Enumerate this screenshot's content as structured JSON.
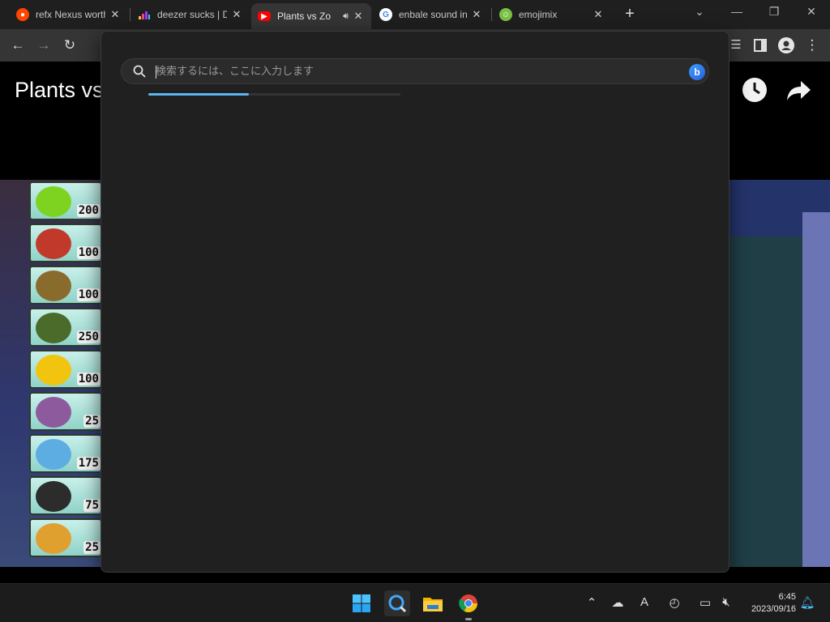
{
  "tabs": [
    {
      "title": "refx Nexus worth",
      "favicon": "reddit-icon",
      "color": "#ff4500"
    },
    {
      "title": "deezer sucks | D",
      "favicon": "deezer-icon",
      "color": "#a238ff"
    },
    {
      "title": "Plants vs Zo",
      "favicon": "youtube-icon",
      "color": "#ff0000",
      "active": true,
      "audio": "speaker-icon"
    },
    {
      "title": "enbale sound in",
      "favicon": "google-icon",
      "color": "#4285f4"
    },
    {
      "title": "emojimix",
      "favicon": "emojimix-icon",
      "color": "#7ac143"
    }
  ],
  "page": {
    "video_title": "Plants vs",
    "seed_costs": [
      "200",
      "100",
      "100",
      "250",
      "100",
      "25",
      "175",
      "75",
      "25"
    ]
  },
  "search": {
    "placeholder": "検索するには、ここに入力します",
    "value": "",
    "progress_percent": 40
  },
  "clock": {
    "time": "6:45",
    "date": "2023/09/16"
  },
  "colors": {
    "accent": "#5db5f0",
    "popup_bg": "#202020",
    "taskbar_bg": "#1c1c1c"
  }
}
